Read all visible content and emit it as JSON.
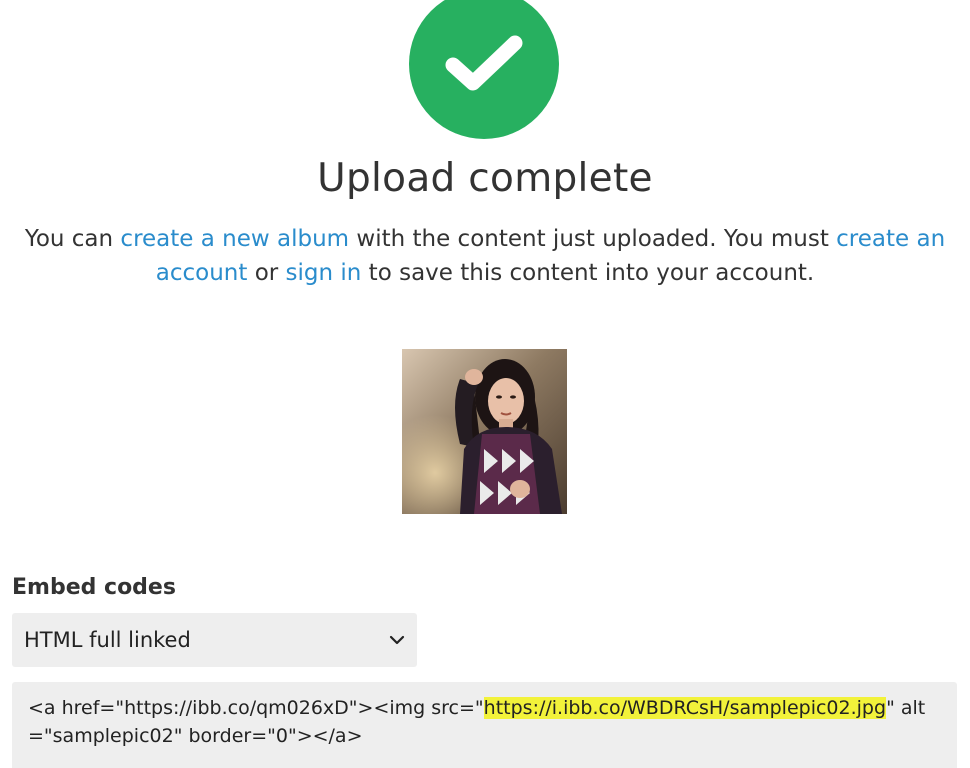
{
  "status": {
    "icon": "check-icon",
    "title": "Upload complete",
    "accent_color": "#27b060"
  },
  "message": {
    "prefix": "You can ",
    "link_new_album": "create a new album",
    "middle1": " with the content just uploaded. You must ",
    "link_create_account": "create an account",
    "middle2": " or ",
    "link_sign_in": "sign in",
    "suffix": " to save this content into your account.",
    "link_color": "#2a8ccc"
  },
  "preview": {
    "alt": "samplepic02"
  },
  "embed": {
    "label": "Embed codes",
    "selected_option": "HTML full linked",
    "code_part1": "<a href=\"https://ibb.co/qm026xD\"><img src=\"",
    "code_highlight": "https://i.ibb.co/WBDRCsH/samplepic02.jpg",
    "code_part2": "\" alt=\"samplepic02\" border=\"0\"></a>"
  }
}
